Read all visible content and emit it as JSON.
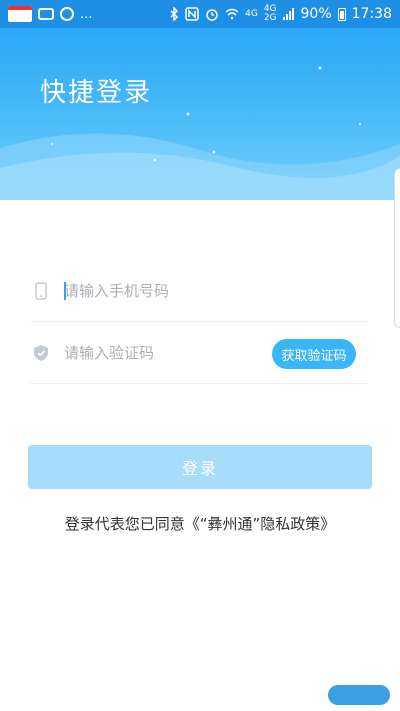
{
  "statusbar": {
    "network_left": "4G",
    "network_right": "4G",
    "network_sub": "2G",
    "battery": "90%",
    "time": "17:38",
    "ellipsis": "..."
  },
  "header": {
    "title": "快捷登录"
  },
  "form": {
    "phone_placeholder": "请输入手机号码",
    "code_placeholder": "请输入验证码",
    "get_code_label": "获取验证码",
    "login_label": "登录"
  },
  "agreement": {
    "prefix": "登录代表您已同意",
    "link": "《“彝州通”隐私政策》"
  },
  "colors": {
    "accent": "#3ab5f7",
    "statusbar": "#1f8fe6",
    "login_disabled": "#a8dcfb"
  },
  "icons": {
    "phone": "phone-icon",
    "shield": "shield-icon"
  }
}
